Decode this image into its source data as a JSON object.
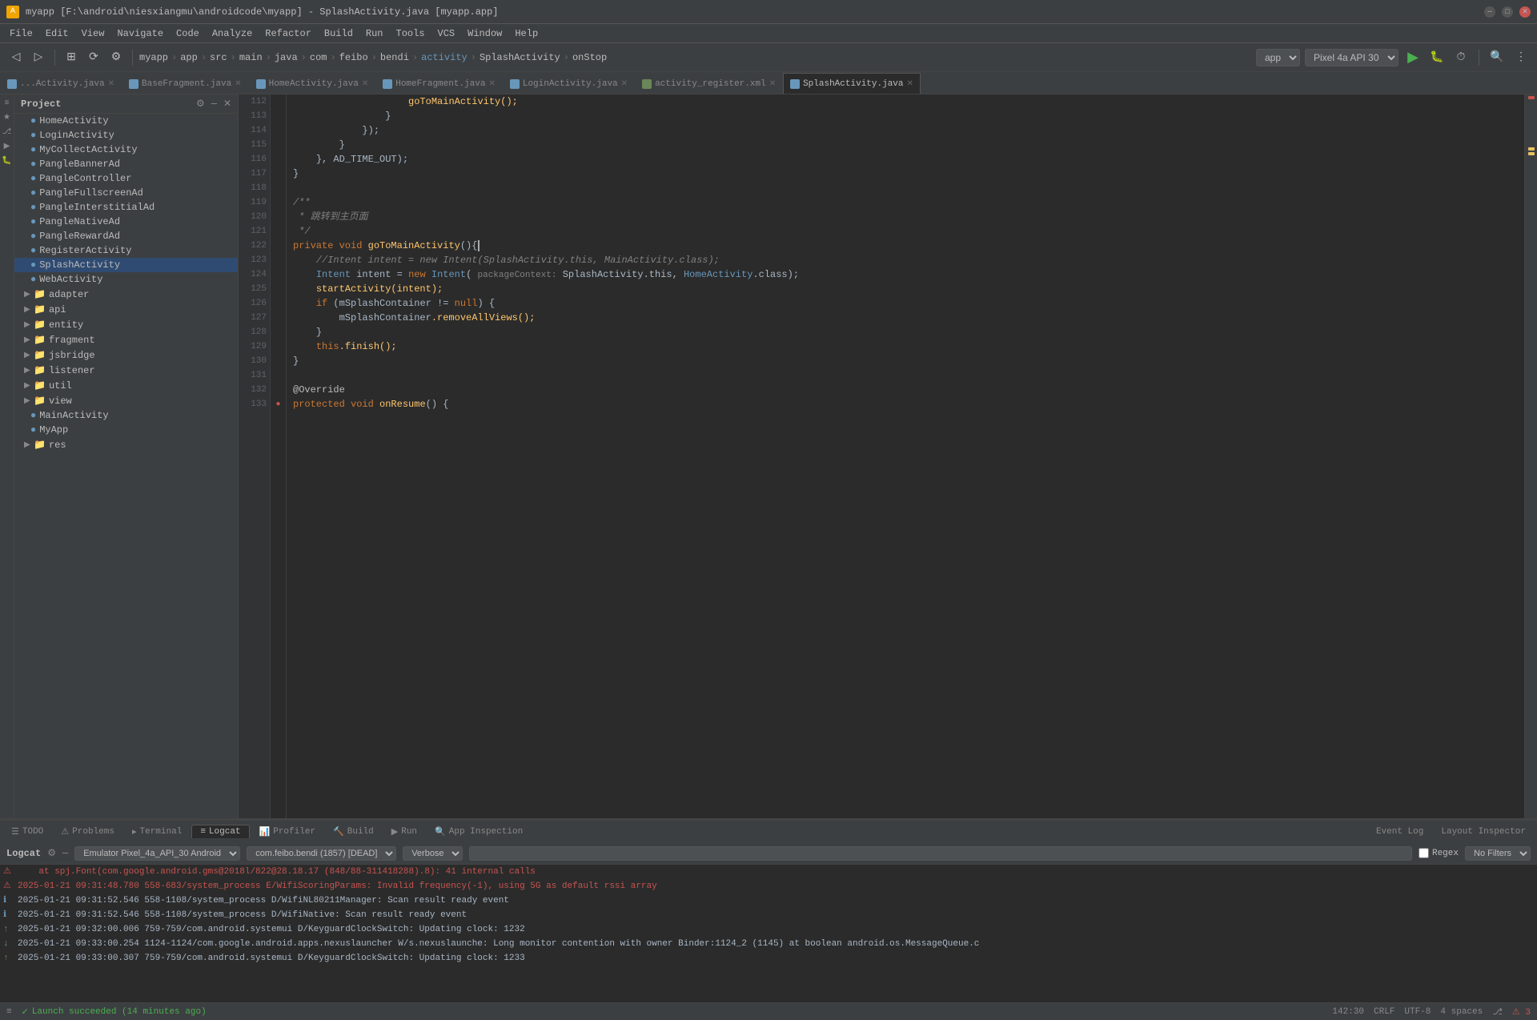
{
  "titleBar": {
    "title": "myapp [F:\\android\\niesxiangmu\\androidcode\\myapp] - SplashActivity.java [myapp.app]",
    "icon": "A"
  },
  "menuBar": {
    "items": [
      "File",
      "Edit",
      "View",
      "Navigate",
      "Code",
      "Analyze",
      "Refactor",
      "Build",
      "Run",
      "Tools",
      "VCS",
      "Window",
      "Help"
    ]
  },
  "toolbar": {
    "breadcrumb": [
      "myapp",
      "app",
      "src",
      "main",
      "java",
      "com",
      "feibo",
      "bendi",
      "activity",
      "SplashActivity",
      "onStop"
    ],
    "appSelector": "app",
    "deviceSelector": "Pixel 4a API 30",
    "runLabel": "▶"
  },
  "tabs": [
    {
      "label": "...Activity.java",
      "type": "java",
      "active": false
    },
    {
      "label": "BaseFragment.java",
      "type": "java",
      "active": false
    },
    {
      "label": "HomeActivity.java",
      "type": "java",
      "active": false
    },
    {
      "label": "HomeFragment.java",
      "type": "java",
      "active": false
    },
    {
      "label": "LoginActivity.java",
      "type": "java",
      "active": false
    },
    {
      "label": "activity_register.xml",
      "type": "xml",
      "active": false
    },
    {
      "label": "SplashActivity.java",
      "type": "java",
      "active": true
    }
  ],
  "sidebar": {
    "projectLabel": "Project",
    "treeItems": [
      {
        "label": "HomeActivity",
        "level": 1,
        "type": "activity",
        "expanded": false
      },
      {
        "label": "LoginActivity",
        "level": 1,
        "type": "activity",
        "expanded": false
      },
      {
        "label": "MyCollectActivity",
        "level": 1,
        "type": "activity",
        "expanded": false
      },
      {
        "label": "PangleBannerAd",
        "level": 1,
        "type": "activity",
        "expanded": false
      },
      {
        "label": "PangleController",
        "level": 1,
        "type": "activity",
        "expanded": false
      },
      {
        "label": "PangleFullscreenAd",
        "level": 1,
        "type": "activity",
        "expanded": false
      },
      {
        "label": "PangleInterstitialAd",
        "level": 1,
        "type": "activity",
        "expanded": false
      },
      {
        "label": "PangleNativeAd",
        "level": 1,
        "type": "activity",
        "expanded": false
      },
      {
        "label": "PangleRewardAd",
        "level": 1,
        "type": "activity",
        "expanded": false
      },
      {
        "label": "RegisterActivity",
        "level": 1,
        "type": "activity",
        "expanded": false
      },
      {
        "label": "SplashActivity",
        "level": 1,
        "type": "activity",
        "expanded": false,
        "selected": true
      },
      {
        "label": "WebActivity",
        "level": 1,
        "type": "activity",
        "expanded": false
      },
      {
        "label": "adapter",
        "level": 1,
        "type": "folder",
        "expanded": false
      },
      {
        "label": "api",
        "level": 1,
        "type": "folder",
        "expanded": false
      },
      {
        "label": "entity",
        "level": 1,
        "type": "folder",
        "expanded": false
      },
      {
        "label": "fragment",
        "level": 1,
        "type": "folder",
        "expanded": false
      },
      {
        "label": "jsbridge",
        "level": 1,
        "type": "folder",
        "expanded": false
      },
      {
        "label": "listener",
        "level": 1,
        "type": "folder",
        "expanded": false
      },
      {
        "label": "util",
        "level": 1,
        "type": "folder",
        "expanded": false
      },
      {
        "label": "view",
        "level": 1,
        "type": "folder",
        "expanded": false
      },
      {
        "label": "MainActivity",
        "level": 1,
        "type": "activity",
        "expanded": false
      },
      {
        "label": "MyApp",
        "level": 1,
        "type": "activity",
        "expanded": false
      },
      {
        "label": "res",
        "level": 1,
        "type": "folder",
        "expanded": false
      }
    ]
  },
  "codeLines": [
    {
      "num": 112,
      "content": "                    goToMainActivity();",
      "tokens": [
        {
          "text": "                    goToMainActivity();",
          "class": "fn"
        }
      ]
    },
    {
      "num": 113,
      "content": "                }",
      "tokens": [
        {
          "text": "                }",
          "class": "punct"
        }
      ]
    },
    {
      "num": 114,
      "content": "            });",
      "tokens": [
        {
          "text": "            });",
          "class": "punct"
        }
      ]
    },
    {
      "num": 115,
      "content": "        }",
      "tokens": [
        {
          "text": "        }",
          "class": "punct"
        }
      ]
    },
    {
      "num": 116,
      "content": "    }, AD_TIME_OUT);",
      "tokens": [
        {
          "text": "    }, ",
          "class": "punct"
        },
        {
          "text": "AD_TIME_OUT",
          "class": "cn"
        },
        {
          "text": ");",
          "class": "punct"
        }
      ]
    },
    {
      "num": 117,
      "content": "}",
      "tokens": [
        {
          "text": "}",
          "class": "punct"
        }
      ]
    },
    {
      "num": 118,
      "content": "",
      "tokens": []
    },
    {
      "num": 119,
      "content": "/**",
      "tokens": [
        {
          "text": "/**",
          "class": "comment"
        }
      ]
    },
    {
      "num": 120,
      "content": " * 跳转到主页面",
      "tokens": [
        {
          "text": " * 跳转到主页面",
          "class": "comment"
        }
      ]
    },
    {
      "num": 121,
      "content": " */",
      "tokens": [
        {
          "text": " */",
          "class": "comment"
        }
      ]
    },
    {
      "num": 122,
      "content": "private void goToMainActivity(){",
      "tokens": [
        {
          "text": "private ",
          "class": "kw"
        },
        {
          "text": "void ",
          "class": "kw"
        },
        {
          "text": "goToMainActivity",
          "class": "fn"
        },
        {
          "text": "(){",
          "class": "punct"
        }
      ]
    },
    {
      "num": 123,
      "content": "    //Intent intent = new Intent(SplashActivity.this, MainActivity.class);",
      "tokens": [
        {
          "text": "    //Intent intent = new Intent(SplashActivity.this, MainActivity.class);",
          "class": "comment"
        }
      ]
    },
    {
      "num": 124,
      "content": "    Intent intent = new Intent( packageContext: SplashActivity.this, HomeActivity.class);",
      "tokens": [
        {
          "text": "    ",
          "class": "cn"
        },
        {
          "text": "Intent",
          "class": "type"
        },
        {
          "text": " intent = ",
          "class": "cn"
        },
        {
          "text": "new ",
          "class": "kw"
        },
        {
          "text": "Intent",
          "class": "type"
        },
        {
          "text": "( ",
          "class": "punct"
        },
        {
          "text": "packageContext:",
          "class": "param-hint"
        },
        {
          "text": " SplashActivity",
          "class": "cn"
        },
        {
          "text": ".this, ",
          "class": "cn"
        },
        {
          "text": "HomeActivity",
          "class": "type"
        },
        {
          "text": ".class);",
          "class": "cn"
        }
      ]
    },
    {
      "num": 125,
      "content": "    startActivity(intent);",
      "tokens": [
        {
          "text": "    startActivity(intent);",
          "class": "fn"
        }
      ]
    },
    {
      "num": 126,
      "content": "    if (mSplashContainer != null) {",
      "tokens": [
        {
          "text": "    ",
          "class": "cn"
        },
        {
          "text": "if",
          "class": "kw"
        },
        {
          "text": " (mSplashContainer != ",
          "class": "cn"
        },
        {
          "text": "null",
          "class": "kw"
        },
        {
          "text": ") {",
          "class": "cn"
        }
      ]
    },
    {
      "num": 127,
      "content": "        mSplashContainer.removeAllViews();",
      "tokens": [
        {
          "text": "        mSplashContainer",
          "class": "var"
        },
        {
          "text": ".removeAllViews();",
          "class": "fn"
        }
      ]
    },
    {
      "num": 128,
      "content": "    }",
      "tokens": [
        {
          "text": "    }",
          "class": "punct"
        }
      ]
    },
    {
      "num": 129,
      "content": "    this.finish();",
      "tokens": [
        {
          "text": "    ",
          "class": "cn"
        },
        {
          "text": "this",
          "class": "kw"
        },
        {
          "text": ".finish();",
          "class": "fn"
        }
      ]
    },
    {
      "num": 130,
      "content": "}",
      "tokens": [
        {
          "text": "}",
          "class": "punct"
        }
      ]
    },
    {
      "num": 131,
      "content": "",
      "tokens": []
    },
    {
      "num": 132,
      "content": "@Override",
      "tokens": [
        {
          "text": "@Override",
          "class": "annotation"
        }
      ]
    },
    {
      "num": 133,
      "content": "protected void onResume() {",
      "tokens": [
        {
          "text": "protected ",
          "class": "kw"
        },
        {
          "text": "void ",
          "class": "kw"
        },
        {
          "text": "onResume",
          "class": "fn"
        },
        {
          "text": "() {",
          "class": "punct"
        }
      ]
    }
  ],
  "logcat": {
    "panelLabel": "Logcat",
    "deviceLabel": "Emulator Pixel_4a_API_30 Android",
    "packageLabel": "com.feibo.bendi (1857) [DEAD]",
    "verboseLabel": "Verbose",
    "filterPlaceholder": "",
    "regexLabel": "Regex",
    "noFiltersLabel": "No Filters",
    "gearIcon": "⚙",
    "lines": [
      {
        "icon": "warn",
        "text": "at spj.Font(com.google.android.gms@2018l/822@28.18.17 (848/88-311418288).8): 41 internal calls"
      },
      {
        "icon": "warn",
        "text": "2025-01-21 09:31:48.780 558-683/system_process E/WifiScoringParams: Invalid frequency(-1), using 5G as default rssi array"
      },
      {
        "icon": "default",
        "text": "2025-01-21 09:31:52.546 558-1108/system_process D/WifiNL80211Manager: Scan result ready event"
      },
      {
        "icon": "default",
        "text": "2025-01-21 09:31:52.546 558-1108/system_process D/WifiNative: Scan result ready event"
      },
      {
        "icon": "up",
        "text": "2025-01-21 09:32:00.006 759-759/com.android.systemui D/KeyguardClockSwitch: Updating clock: 1232"
      },
      {
        "icon": "down",
        "text": "2025-01-21 09:33:00.254 1124-1124/com.google.android.apps.nexuslauncher W/s.nexuslaunche: Long monitor contention with owner Binder:1124_2 (1145) at boolean android.os.MessageQueue.c"
      },
      {
        "icon": "up",
        "text": "2025-01-21 09:33:00.307 759-759/com.android.systemui D/KeyguardClockSwitch: Updating clock: 1233"
      }
    ]
  },
  "bottomTabs": [
    {
      "label": "TODO",
      "active": false,
      "icon": "☰"
    },
    {
      "label": "Problems",
      "active": false,
      "icon": "⚠"
    },
    {
      "label": "Terminal",
      "active": false,
      "icon": ">_"
    },
    {
      "label": "Logcat",
      "active": true,
      "icon": "📋"
    },
    {
      "label": "Profiler",
      "active": false,
      "icon": "📊"
    },
    {
      "label": "Build",
      "active": false,
      "icon": "🔨"
    },
    {
      "label": "Run",
      "active": false,
      "icon": "▶"
    },
    {
      "label": "App Inspection",
      "active": false,
      "icon": "🔍"
    }
  ],
  "statusBar": {
    "launchStatus": "Launch succeeded (14 minutes ago)",
    "position": "142:30",
    "lineEnding": "CRLF",
    "encoding": "UTF-8",
    "indent": "4 spaces",
    "eventLog": "Event Log",
    "layoutInspector": "Layout Inspector"
  }
}
